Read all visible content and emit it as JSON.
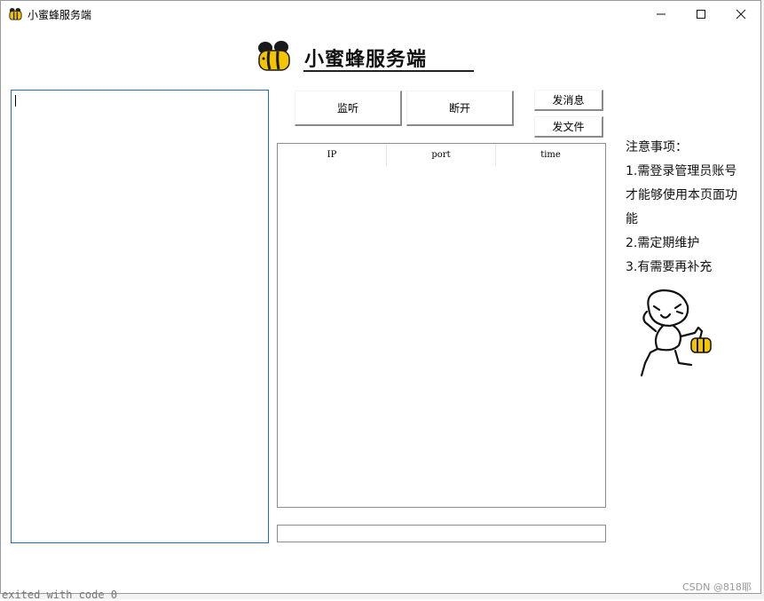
{
  "window": {
    "title": "小蜜蜂服务端",
    "controls": {
      "minimize": "minimize-icon",
      "maximize": "maximize-icon",
      "close": "close-icon"
    }
  },
  "header": {
    "heading": "小蜜蜂服务端",
    "logo": "bee-logo"
  },
  "buttons": {
    "listen": "监听",
    "disconnect": "断开",
    "send_message": "发消息",
    "send_file": "发文件"
  },
  "connection_table": {
    "columns": [
      "IP",
      "port",
      "time"
    ],
    "rows": []
  },
  "log_area": {
    "value": ""
  },
  "message_input": {
    "value": ""
  },
  "notes": {
    "title": "注意事项：",
    "lines": [
      "1.需登录管理员账号",
      "才能够使用本页面功",
      "能",
      "2.需定期维护",
      "3.有需要再补充"
    ]
  },
  "footer": {
    "background_text": "exited with code 0",
    "watermark": "CSDN @818耶"
  },
  "colors": {
    "accent_border": "#1e6fbf",
    "bee_yellow": "#f5c400"
  }
}
